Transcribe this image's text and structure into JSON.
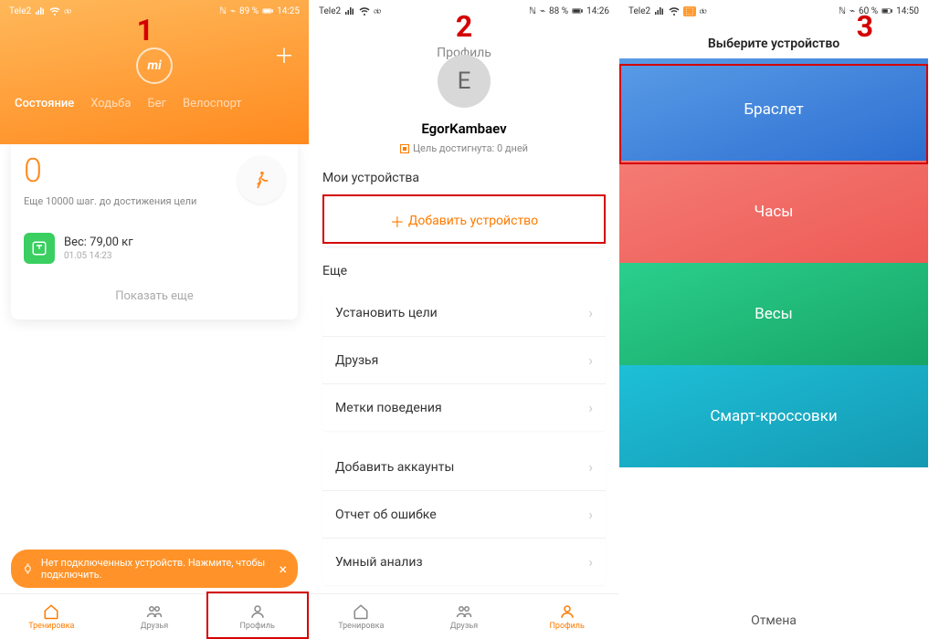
{
  "screen1": {
    "step": "1",
    "status": {
      "carrier": "Tele2",
      "battery": "89 %",
      "time": "14:25"
    },
    "logo": "mi",
    "tabs": [
      "Состояние",
      "Ходьба",
      "Бег",
      "Велоспорт"
    ],
    "steps_count": "0",
    "steps_sub": "Еще 10000 шаг. до достижения цели",
    "weight_label": "Вес: 79,00  кг",
    "weight_time": "01.05 14:23",
    "show_more": "Показать еще",
    "toast": "Нет подключенных устройств. Нажмите, чтобы подключить.",
    "nav": {
      "workout": "Тренировка",
      "friends": "Друзья",
      "profile": "Профиль"
    }
  },
  "screen2": {
    "step": "2",
    "status": {
      "carrier": "Tele2",
      "battery": "88 %",
      "time": "14:26"
    },
    "page_title": "Профиль",
    "avatar_letter": "E",
    "username": "EgorKambaev",
    "goal_text": "Цель достигнута: 0 дней",
    "section_devices": "Мои устройства",
    "add_device": "Добавить устройство",
    "section_more": "Еще",
    "list1": [
      "Установить цели",
      "Друзья",
      "Метки поведения"
    ],
    "list2": [
      "Добавить аккаунты",
      "Отчет об ошибке",
      "Умный анализ"
    ],
    "nav": {
      "workout": "Тренировка",
      "friends": "Друзья",
      "profile": "Профиль"
    }
  },
  "screen3": {
    "step": "3",
    "status": {
      "carrier": "Tele2",
      "battery": "60 %",
      "time": "14:50"
    },
    "title": "Выберите устройство",
    "tiles": {
      "bracelet": "Браслет",
      "watch": "Часы",
      "scale": "Весы",
      "shoes": "Смарт-кроссовки"
    },
    "cancel": "Отмена"
  }
}
